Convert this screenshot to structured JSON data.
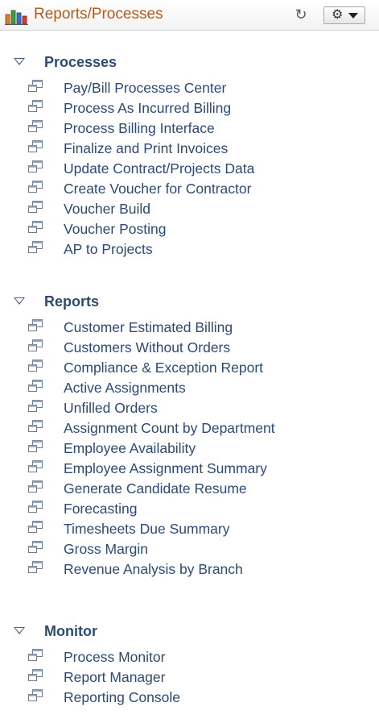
{
  "header": {
    "title": "Reports/Processes",
    "title_color": "#b45a1b",
    "chart_icon": "bar-chart-icon",
    "refresh_icon": "refresh-icon",
    "menu_icon": "gear-icon",
    "menu_caret_icon": "caret-down-icon"
  },
  "sections": [
    {
      "title": "Processes",
      "items": [
        {
          "label": "Pay/Bill Processes Center"
        },
        {
          "label": "Process As Incurred Billing"
        },
        {
          "label": "Process Billing Interface"
        },
        {
          "label": "Finalize and Print Invoices"
        },
        {
          "label": "Update Contract/Projects Data"
        },
        {
          "label": "Create Voucher for Contractor"
        },
        {
          "label": "Voucher Build"
        },
        {
          "label": "Voucher Posting"
        },
        {
          "label": "AP to Projects"
        }
      ]
    },
    {
      "title": "Reports",
      "items": [
        {
          "label": "Customer Estimated Billing"
        },
        {
          "label": "Customers Without Orders"
        },
        {
          "label": "Compliance & Exception Report"
        },
        {
          "label": "Active Assignments"
        },
        {
          "label": "Unfilled Orders"
        },
        {
          "label": "Assignment Count by Department"
        },
        {
          "label": "Employee Availability"
        },
        {
          "label": "Employee Assignment Summary"
        },
        {
          "label": "Generate Candidate Resume"
        },
        {
          "label": "Forecasting"
        },
        {
          "label": "Timesheets Due Summary"
        },
        {
          "label": "Gross Margin"
        },
        {
          "label": "Revenue Analysis by Branch"
        }
      ]
    },
    {
      "title": "Monitor",
      "items": [
        {
          "label": "Process Monitor"
        },
        {
          "label": "Report Manager"
        },
        {
          "label": "Reporting Console"
        }
      ]
    }
  ],
  "colors": {
    "link": "#2d4a76",
    "section_title": "#2e4b73",
    "expand_triangle": "#4f6178"
  }
}
